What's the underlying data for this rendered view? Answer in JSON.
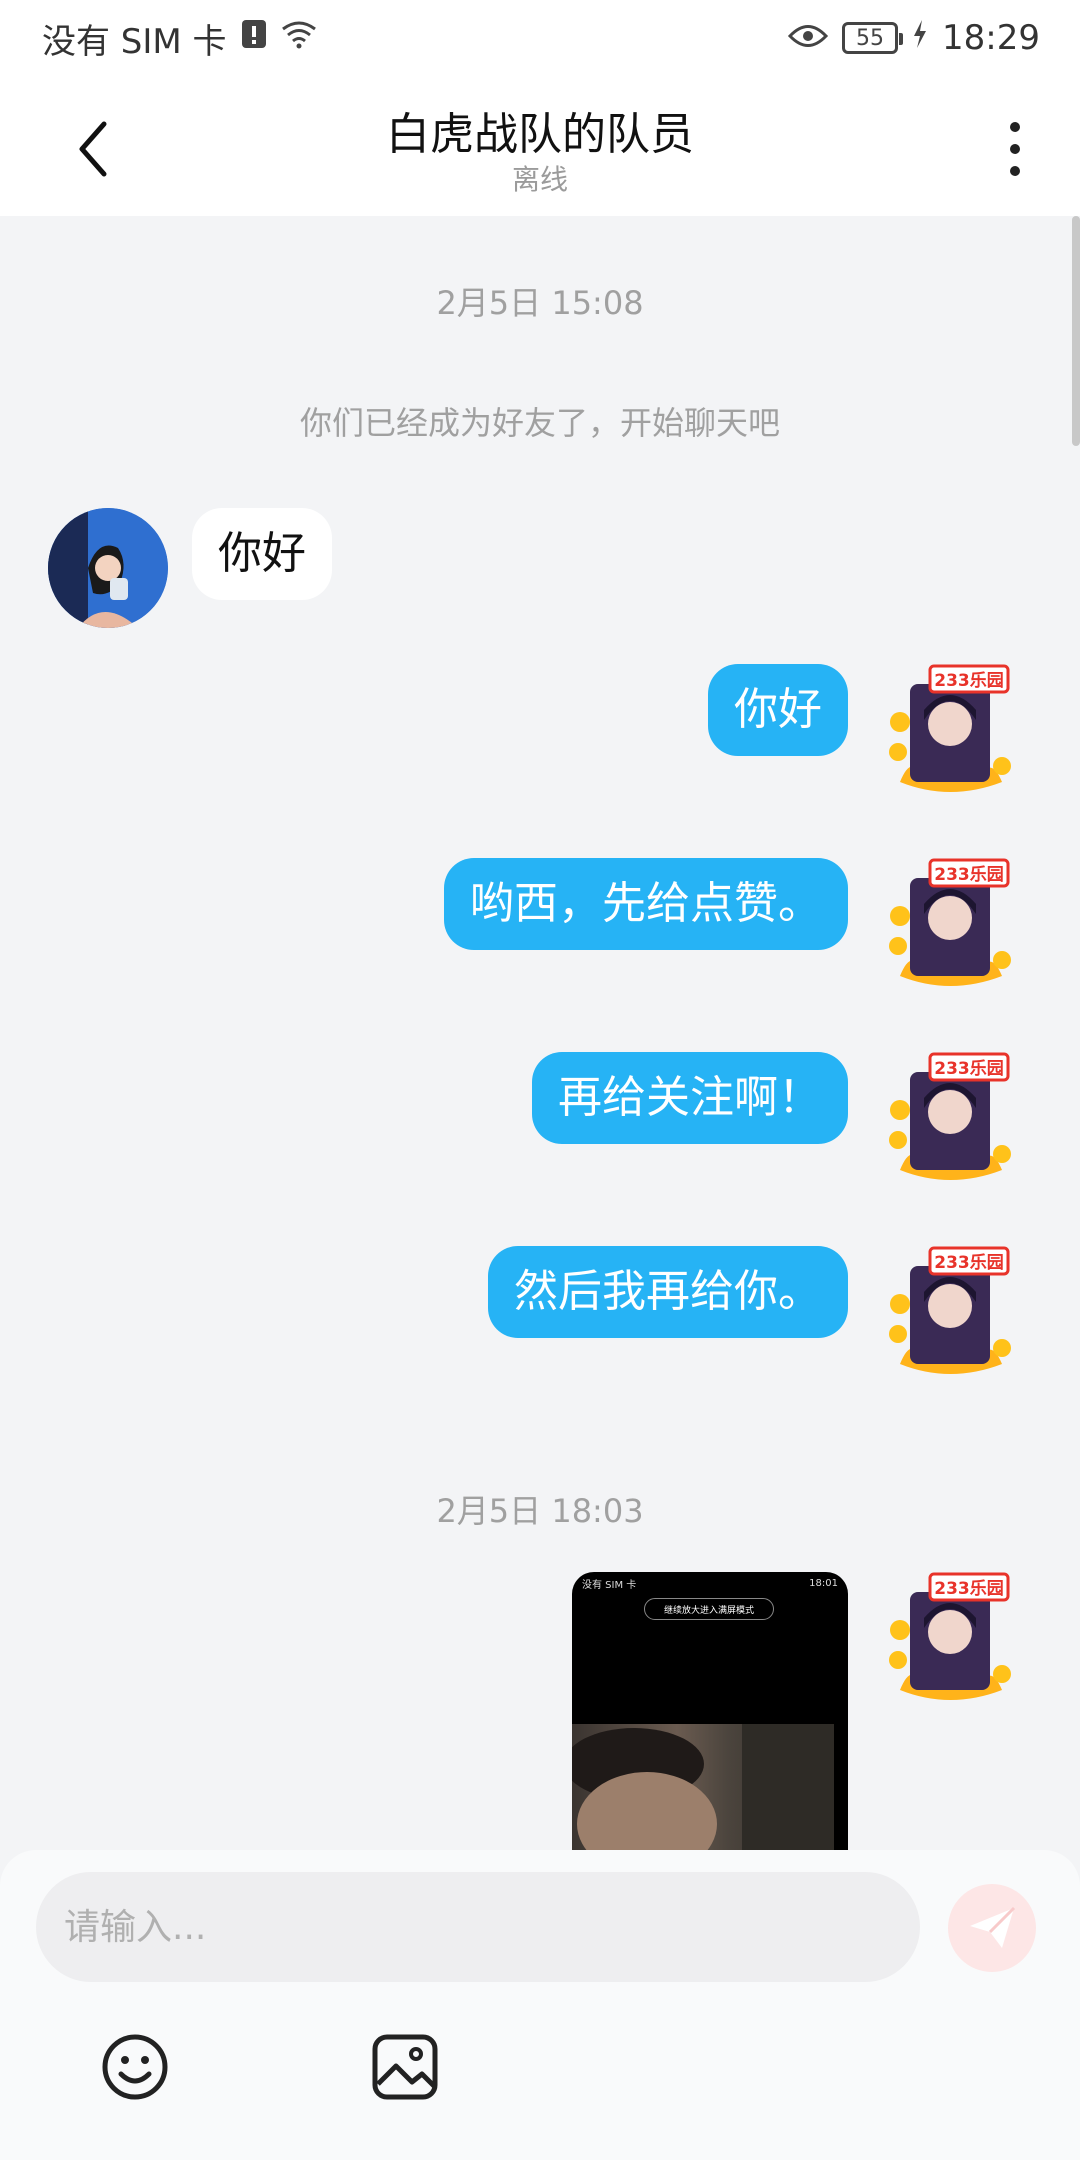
{
  "status_bar": {
    "carrier": "没有 SIM 卡",
    "battery": "55",
    "time": "18:29"
  },
  "header": {
    "title": "白虎战队的队员",
    "status": "离线"
  },
  "chat": {
    "timestamp_1": "2月5日 15:08",
    "system_note": "你们已经成为好友了，开始聊天吧",
    "messages": [
      {
        "from": "other",
        "text": "你好"
      },
      {
        "from": "me",
        "text": "你好"
      },
      {
        "from": "me",
        "text": "哟西，先给点赞。"
      },
      {
        "from": "me",
        "text": "再给关注啊！"
      },
      {
        "from": "me",
        "text": "然后我再给你。"
      }
    ],
    "timestamp_2": "2月5日 18:03",
    "image_message": {
      "carrier": "没有 SIM 卡",
      "time": "18:01",
      "pill_text": "继续放大进入满屏模式"
    },
    "avatar_badge": "233乐园"
  },
  "input": {
    "placeholder": "请输入..."
  },
  "colors": {
    "outgoing_bubble": "#26b3f5",
    "send_button": "#fde6e6"
  }
}
